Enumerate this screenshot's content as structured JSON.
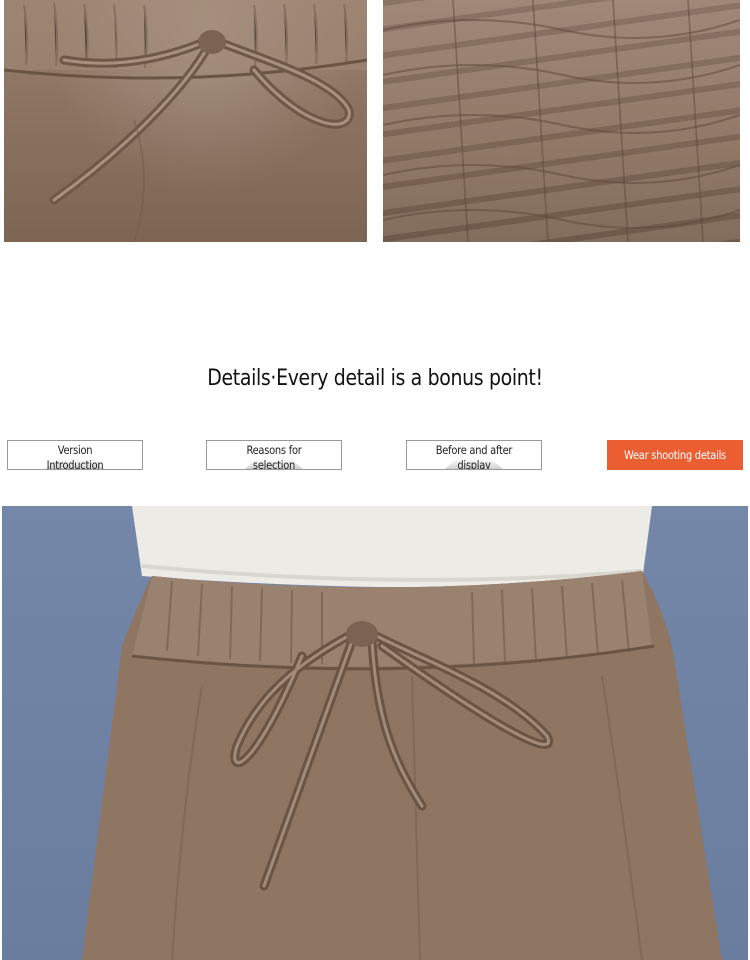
{
  "heading": "Details·Every detail is a bonus point!",
  "tabs": [
    {
      "label": "Version\nIntroduction",
      "active": false
    },
    {
      "label": "Reasons for\nselection",
      "active": false
    },
    {
      "label": "Before and after\ndisplay",
      "active": false
    },
    {
      "label": "Wear shooting details",
      "active": true
    }
  ],
  "colors": {
    "accent": "#ea5e32",
    "fabric": "#8c7361",
    "backdrop": "#6f81a3"
  },
  "icons": {
    "photos": [
      "drawstring-waist-closeup",
      "elastic-waistband-closeup",
      "pants-worn-front-view"
    ]
  }
}
